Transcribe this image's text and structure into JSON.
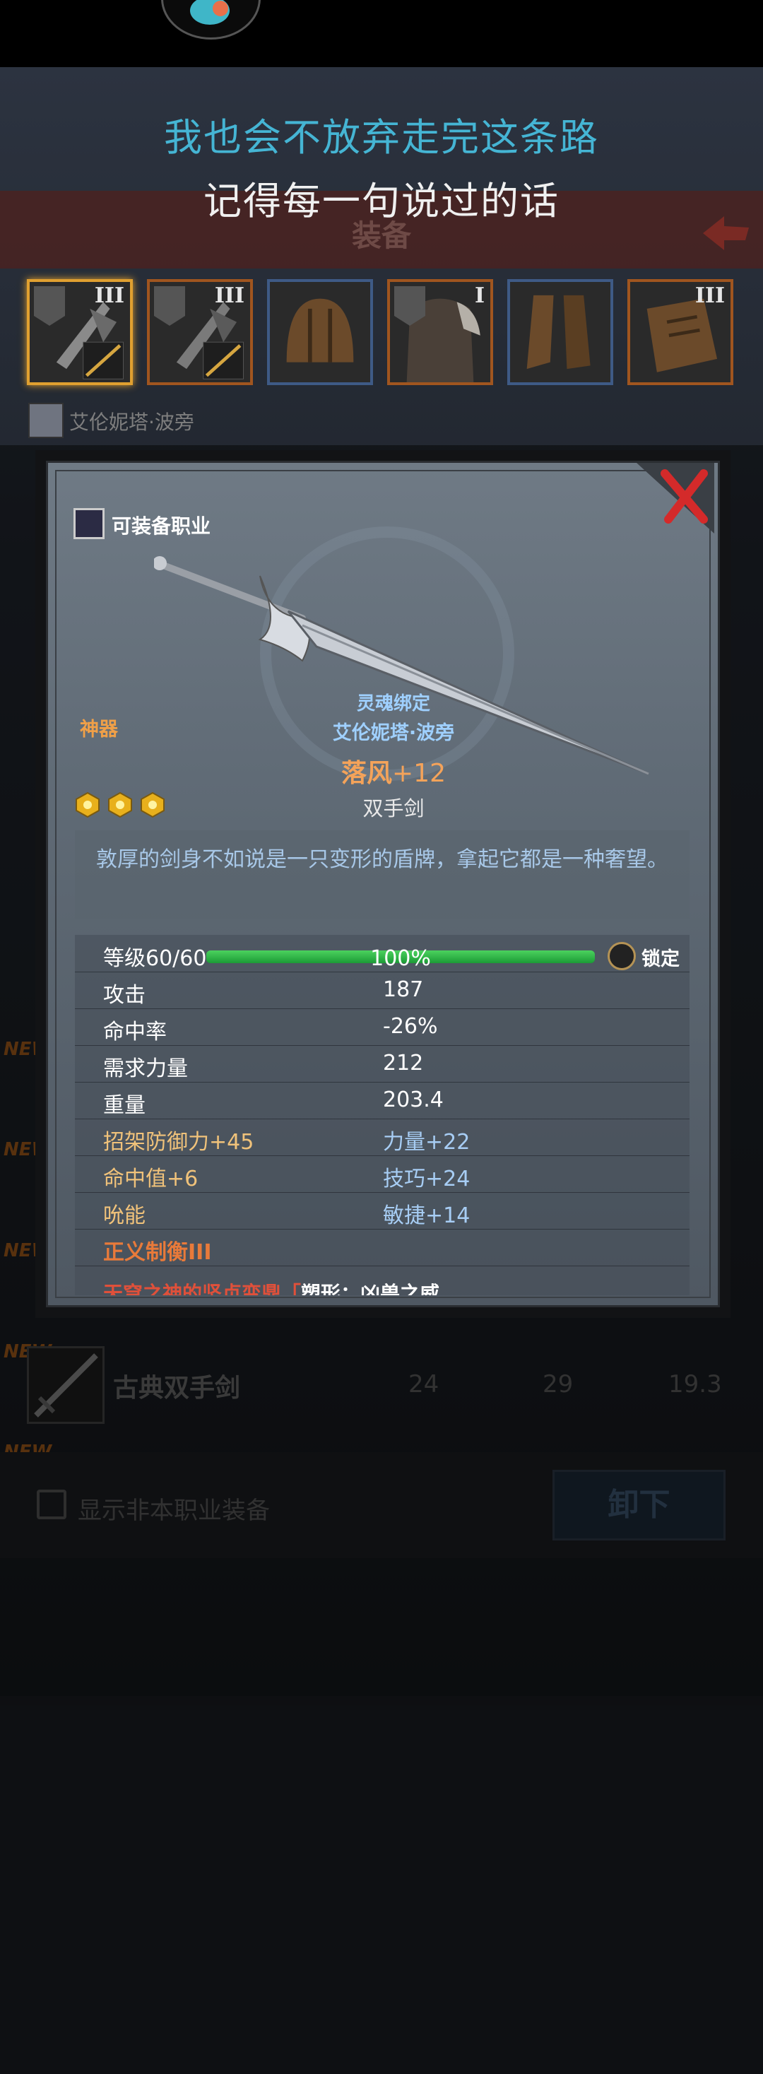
{
  "lyrics": {
    "line1": "我也会不放弃走完这条路",
    "line2": "记得每一句说过的话"
  },
  "screen": {
    "title": "装备"
  },
  "slots": [
    {
      "tier": "III"
    },
    {
      "tier": "III"
    },
    {
      "tier": ""
    },
    {
      "tier": "I"
    },
    {
      "tier": ""
    },
    {
      "tier": "III"
    }
  ],
  "character": {
    "name": "艾伦妮塔·波旁"
  },
  "list": {
    "new_label": "NEW",
    "row": {
      "name": "古典双手剑",
      "v1": "24",
      "v2": "29",
      "v3": "19.3"
    }
  },
  "footer": {
    "show_nonclass_label": "显示非本职业装备",
    "unequip_label": "卸下"
  },
  "modal": {
    "job_label": "可装备职业",
    "artifact_label": "神器",
    "soul_bound": "灵魂绑定",
    "bound_to": "艾伦妮塔·波旁",
    "item_name": "落风",
    "item_enhance": "+12",
    "item_type": "双手剑",
    "gem_count": 3,
    "description": "敦厚的剑身不如说是一只变形的盾牌，拿起它都是一种奢望。",
    "level": {
      "label": "等级",
      "value": "60/60",
      "percent_text": "100%",
      "percent": 100,
      "lock_label": "锁定"
    },
    "stats": [
      {
        "label": "攻击",
        "value": "187"
      },
      {
        "label": "命中率",
        "value": "-26%"
      },
      {
        "label": "需求力量",
        "value": "212"
      },
      {
        "label": "重量",
        "value": "203.4"
      }
    ],
    "bonuses": [
      {
        "left": "招架防御力",
        "left_val": "+45",
        "right": "力量",
        "right_val": "+22"
      },
      {
        "left": "命中值",
        "left_val": "+6",
        "right": "技巧",
        "right_val": "+24"
      },
      {
        "left": "吮能",
        "left_val": "",
        "right": "敏捷",
        "right_val": "+14"
      }
    ],
    "set_bonus": "正义制衡III",
    "cut_line_red": "天穹之神的坚贞变鼎「",
    "cut_line_white": "塑形：凶兽之威"
  },
  "colors": {
    "lyric_accent": "#45b5d4",
    "item_name": "#f4a35a",
    "blue_text": "#a7cdf4",
    "artifact": "#f0a048",
    "set_red": "#e87a3a"
  }
}
